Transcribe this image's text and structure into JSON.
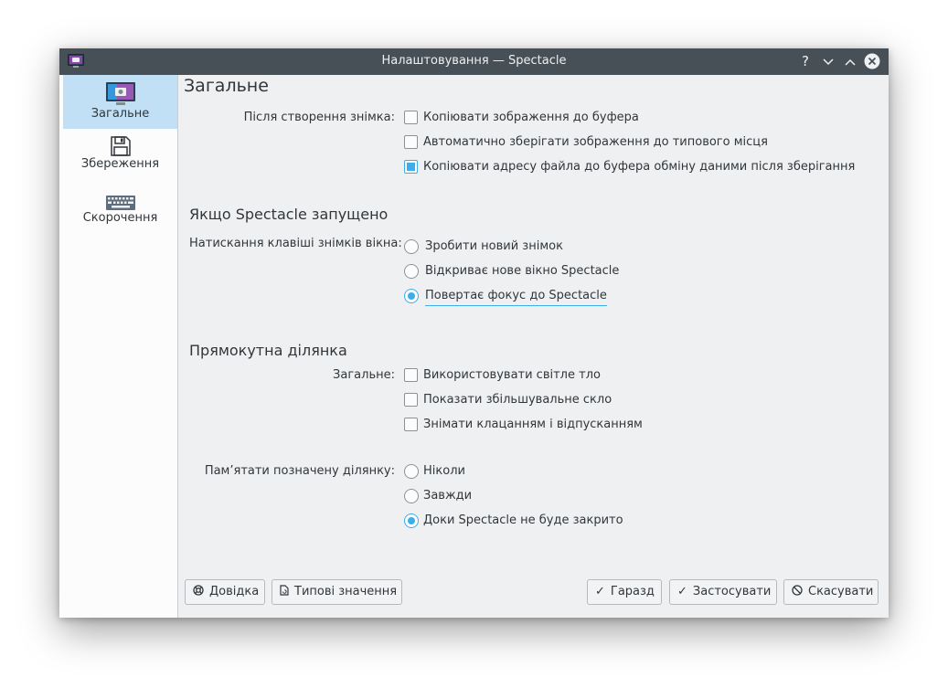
{
  "window": {
    "title": "Налаштовування — Spectacle",
    "help_glyph": "?",
    "minimize_glyph": "⌄",
    "maximize_glyph": "⌃"
  },
  "sidebar": {
    "items": [
      {
        "label": "Загальне",
        "icon": "monitor-screenshot-icon",
        "selected": true
      },
      {
        "label": "Збереження",
        "icon": "floppy-disk-icon",
        "selected": false
      },
      {
        "label": "Скорочення",
        "icon": "keyboard-icon",
        "selected": false
      }
    ]
  },
  "page": {
    "title": "Загальне"
  },
  "after_capture": {
    "label": "Після створення знімка:",
    "options": [
      {
        "label": "Копіювати зображення до буфера",
        "checked": false
      },
      {
        "label": "Автоматично зберігати зображення до типового місця",
        "checked": false
      },
      {
        "label": "Копіювати адресу файла до буфера обміну даними після зберігання",
        "checked": true
      }
    ]
  },
  "running": {
    "title": "Якщо Spectacle запущено",
    "label": "Натискання клавіші знімків вікна:",
    "options": [
      {
        "label": "Зробити новий знімок",
        "checked": false
      },
      {
        "label": "Відкриває нове вікно Spectacle",
        "checked": false
      },
      {
        "label": "Повертає фокус до Spectacle",
        "checked": true
      }
    ]
  },
  "rect": {
    "title": "Прямокутна ділянка",
    "general_label": "Загальне:",
    "general_options": [
      {
        "label": "Використовувати світле тло",
        "checked": false
      },
      {
        "label": "Показати збільшувальне скло",
        "checked": false
      },
      {
        "label": "Знімати клацанням і відпусканням",
        "checked": false
      }
    ],
    "remember_label": "Пам’ятати позначену ділянку:",
    "remember_options": [
      {
        "label": "Ніколи",
        "checked": false
      },
      {
        "label": "Завжди",
        "checked": false
      },
      {
        "label": "Доки Spectacle не буде закрито",
        "checked": true
      }
    ]
  },
  "buttons": {
    "help": "Довідка",
    "defaults": "Типові значення",
    "ok": "Гаразд",
    "apply": "Застосувати",
    "cancel": "Скасувати"
  },
  "colors": {
    "accent": "#3daee9",
    "titlebar": "#475057",
    "window_bg": "#eff0f1",
    "selection": "#c2e0f5"
  }
}
